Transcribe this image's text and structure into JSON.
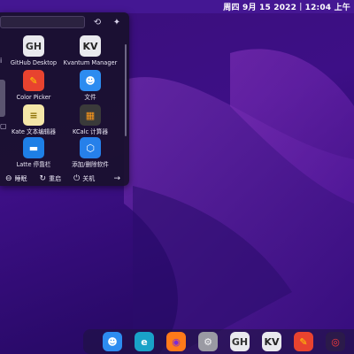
{
  "topbar": {
    "date": "周四 9月 15 2022",
    "separator": "|",
    "time": "12:04 上午"
  },
  "launcher": {
    "search_placeholder": "",
    "header_icons": [
      {
        "name": "refresh-icon",
        "glyph": "⟲"
      },
      {
        "name": "pin-icon",
        "glyph": "✦"
      }
    ],
    "side_glyphs": [
      "i",
      "▢",
      ""
    ],
    "apps": [
      {
        "name": "app-github-desktop",
        "label": "GitHub Desktop",
        "glyph": "GH",
        "bg": "#e9e9ee",
        "fg": "#333333"
      },
      {
        "name": "app-kvantum-manager",
        "label": "Kvantum Manager",
        "glyph": "KV",
        "bg": "#e9e9ee",
        "fg": "#222222"
      },
      {
        "name": "app-color-picker",
        "label": "Color Picker",
        "glyph": "✎",
        "bg": "#e8432f",
        "fg": "#ffd400"
      },
      {
        "name": "app-files",
        "label": "文件",
        "glyph": "☻",
        "bg": "#2d8cf0",
        "fg": "#ffffff"
      },
      {
        "name": "app-kate",
        "label": "Kate 文本编辑器",
        "glyph": "≡",
        "bg": "#f5e6a8",
        "fg": "#8a6d00"
      },
      {
        "name": "app-kcalc",
        "label": "KCalc 计算器",
        "glyph": "▦",
        "bg": "#3a3a3a",
        "fg": "#ff9a1a"
      },
      {
        "name": "app-latte",
        "label": "Latte 停靠栏",
        "glyph": "▬",
        "bg": "#1e7fe6",
        "fg": "#ffffff"
      },
      {
        "name": "app-add-remove",
        "label": "添加/删除软件",
        "glyph": "⬡",
        "bg": "#2680ea",
        "fg": "#ffffff"
      }
    ],
    "bottom": {
      "sleep": "睡眠",
      "restart": "重启",
      "shutdown": "关机",
      "more_glyph": "→"
    }
  },
  "dock": {
    "icons": [
      {
        "name": "dock-files-icon",
        "glyph": "☻",
        "bg": "#2d8cf0",
        "fg": "#ffffff"
      },
      {
        "name": "dock-edge-icon",
        "glyph": "e",
        "bg": "#19a2c8",
        "fg": "#ffffff"
      },
      {
        "name": "dock-firefox-icon",
        "glyph": "◉",
        "bg": "#ff7a1a",
        "fg": "#7b2bd6"
      },
      {
        "name": "dock-settings-icon",
        "glyph": "⚙",
        "bg": "#9a9aa3",
        "fg": "#f3f3f5"
      },
      {
        "name": "dock-github-icon",
        "glyph": "GH",
        "bg": "#e9e9ee",
        "fg": "#333333"
      },
      {
        "name": "dock-kvantum-icon",
        "glyph": "KV",
        "bg": "#e9e9ee",
        "fg": "#222222"
      },
      {
        "name": "dock-colorpicker-icon",
        "glyph": "✎",
        "bg": "#e8432f",
        "fg": "#ffd400"
      },
      {
        "name": "dock-weibo-icon",
        "glyph": "◎",
        "bg": "#2b1a4a",
        "fg": "#ff3a3a"
      }
    ]
  }
}
